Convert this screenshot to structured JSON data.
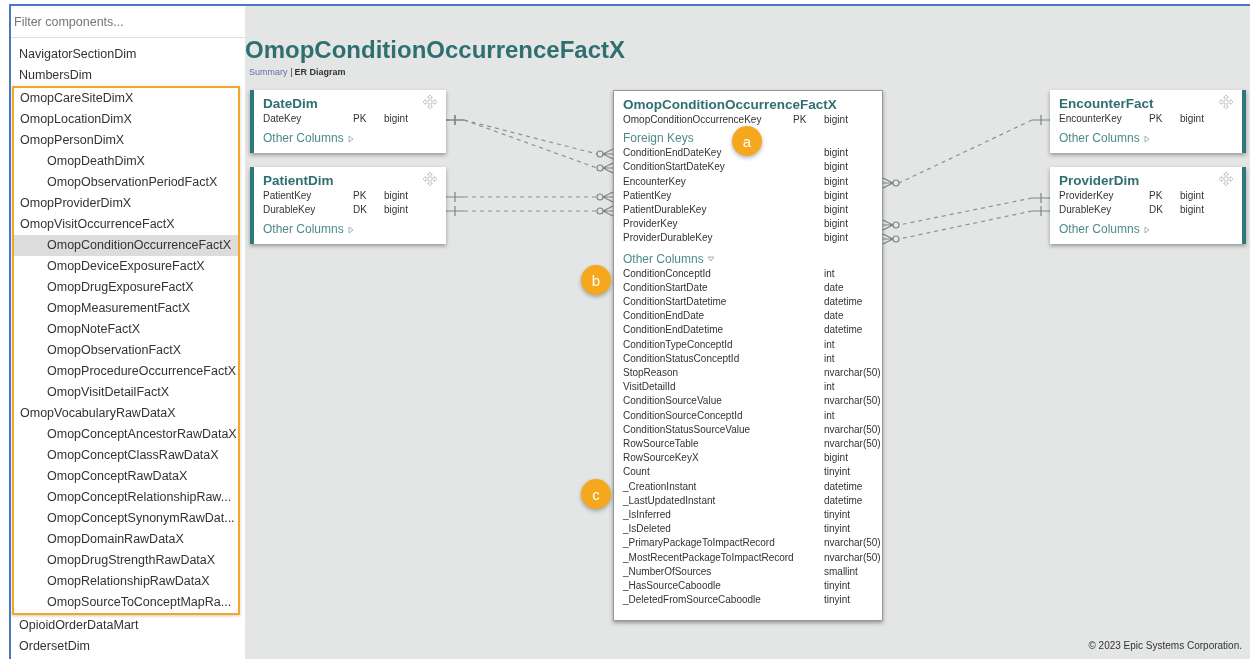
{
  "sidebar": {
    "filter_placeholder": "Filter components...",
    "sections": [
      {
        "highlighted": false,
        "items": [
          {
            "label": "NavigatorSectionDim",
            "selected": false
          },
          {
            "label": "NumbersDim",
            "selected": false
          }
        ]
      },
      {
        "highlighted": true,
        "items": [
          {
            "label": "OmopCareSiteDimX",
            "selected": false
          },
          {
            "label": "OmopLocationDimX",
            "selected": false
          },
          {
            "label": "OmopPersonDimX",
            "selected": false,
            "children": [
              {
                "label": "OmopDeathDimX",
                "selected": false
              },
              {
                "label": "OmopObservationPeriodFactX",
                "selected": false
              }
            ]
          },
          {
            "label": "OmopProviderDimX",
            "selected": false
          },
          {
            "label": "OmopVisitOccurrenceFactX",
            "selected": false,
            "children": [
              {
                "label": "OmopConditionOccurrenceFactX",
                "selected": true
              },
              {
                "label": "OmopDeviceExposureFactX",
                "selected": false
              },
              {
                "label": "OmopDrugExposureFactX",
                "selected": false
              },
              {
                "label": "OmopMeasurementFactX",
                "selected": false
              },
              {
                "label": "OmopNoteFactX",
                "selected": false
              },
              {
                "label": "OmopObservationFactX",
                "selected": false
              },
              {
                "label": "OmopProcedureOccurrenceFactX",
                "selected": false
              },
              {
                "label": "OmopVisitDetailFactX",
                "selected": false
              }
            ]
          },
          {
            "label": "OmopVocabularyRawDataX",
            "selected": false,
            "children": [
              {
                "label": "OmopConceptAncestorRawDataX",
                "selected": false
              },
              {
                "label": "OmopConceptClassRawDataX",
                "selected": false
              },
              {
                "label": "OmopConceptRawDataX",
                "selected": false
              },
              {
                "label": "OmopConceptRelationshipRaw...",
                "selected": false
              },
              {
                "label": "OmopConceptSynonymRawDat...",
                "selected": false
              },
              {
                "label": "OmopDomainRawDataX",
                "selected": false
              },
              {
                "label": "OmopDrugStrengthRawDataX",
                "selected": false
              },
              {
                "label": "OmopRelationshipRawDataX",
                "selected": false
              },
              {
                "label": "OmopSourceToConceptMapRa...",
                "selected": false
              }
            ]
          }
        ]
      },
      {
        "highlighted": false,
        "items": [
          {
            "label": "OpioidOrderDataMart",
            "selected": false
          },
          {
            "label": "OrdersetDim",
            "selected": false
          }
        ]
      }
    ]
  },
  "page": {
    "title": "OmopConditionOccurrenceFactX",
    "tabs": [
      {
        "label": "Summary",
        "selected": false
      },
      {
        "label": "ER Diagram",
        "selected": true
      }
    ],
    "tables": [
      {
        "name": "DateDim",
        "kind": "related",
        "key_columns": [
          {
            "name": "DateKey",
            "key": "PK",
            "type": "bigint"
          }
        ],
        "other_columns": {
          "label": "Other Columns",
          "expanded": false
        }
      },
      {
        "name": "PatientDim",
        "kind": "related",
        "key_columns": [
          {
            "name": "PatientKey",
            "key": "PK",
            "type": "bigint"
          },
          {
            "name": "DurableKey",
            "key": "DK",
            "type": "bigint"
          }
        ],
        "other_columns": {
          "label": "Other Columns",
          "expanded": false
        }
      },
      {
        "name": "OmopConditionOccurrenceFactX",
        "kind": "focus",
        "key_columns": [
          {
            "name": "OmopConditionOccurrenceKey",
            "key": "PK",
            "type": "bigint"
          }
        ],
        "foreign_keys": {
          "label": "Foreign Keys",
          "columns": [
            {
              "name": "ConditionEndDateKey",
              "type": "bigint"
            },
            {
              "name": "ConditionStartDateKey",
              "type": "bigint"
            },
            {
              "name": "EncounterKey",
              "type": "bigint"
            },
            {
              "name": "PatientKey",
              "type": "bigint"
            },
            {
              "name": "PatientDurableKey",
              "type": "bigint"
            },
            {
              "name": "ProviderKey",
              "type": "bigint"
            },
            {
              "name": "ProviderDurableKey",
              "type": "bigint"
            }
          ]
        },
        "other_columns": {
          "label": "Other Columns",
          "expanded": true,
          "columns": [
            {
              "name": "ConditionConceptId",
              "type": "int"
            },
            {
              "name": "ConditionStartDate",
              "type": "date"
            },
            {
              "name": "ConditionStartDatetime",
              "type": "datetime"
            },
            {
              "name": "ConditionEndDate",
              "type": "date"
            },
            {
              "name": "ConditionEndDatetime",
              "type": "datetime"
            },
            {
              "name": "ConditionTypeConceptId",
              "type": "int"
            },
            {
              "name": "ConditionStatusConceptId",
              "type": "int"
            },
            {
              "name": "StopReason",
              "type": "nvarchar(50)"
            },
            {
              "name": "VisitDetailId",
              "type": "int"
            },
            {
              "name": "ConditionSourceValue",
              "type": "nvarchar(50)"
            },
            {
              "name": "ConditionSourceConceptId",
              "type": "int"
            },
            {
              "name": "ConditionStatusSourceValue",
              "type": "nvarchar(50)"
            },
            {
              "name": "RowSourceTable",
              "type": "nvarchar(50)"
            },
            {
              "name": "RowSourceKeyX",
              "type": "bigint"
            },
            {
              "name": "Count",
              "type": "tinyint"
            },
            {
              "name": "_CreationInstant",
              "type": "datetime"
            },
            {
              "name": "_LastUpdatedInstant",
              "type": "datetime"
            },
            {
              "name": "_IsInferred",
              "type": "tinyint"
            },
            {
              "name": "_IsDeleted",
              "type": "tinyint"
            },
            {
              "name": "_PrimaryPackageToImpactRecord",
              "type": "nvarchar(50)"
            },
            {
              "name": "_MostRecentPackageToImpactRecord",
              "type": "nvarchar(50)"
            },
            {
              "name": "_NumberOfSources",
              "type": "smallint"
            },
            {
              "name": "_HasSourceCaboodle",
              "type": "tinyint"
            },
            {
              "name": "_DeletedFromSourceCaboodle",
              "type": "tinyint"
            }
          ]
        }
      },
      {
        "name": "EncounterFact",
        "kind": "related",
        "key_columns": [
          {
            "name": "EncounterKey",
            "key": "PK",
            "type": "bigint"
          }
        ],
        "other_columns": {
          "label": "Other Columns",
          "expanded": false
        }
      },
      {
        "name": "ProviderDim",
        "kind": "related",
        "key_columns": [
          {
            "name": "ProviderKey",
            "key": "PK",
            "type": "bigint"
          },
          {
            "name": "DurableKey",
            "key": "DK",
            "type": "bigint"
          }
        ],
        "other_columns": {
          "label": "Other Columns",
          "expanded": false
        }
      }
    ],
    "callouts": [
      "a",
      "b",
      "c"
    ],
    "copyright": "© 2023 Epic Systems Corporation."
  }
}
